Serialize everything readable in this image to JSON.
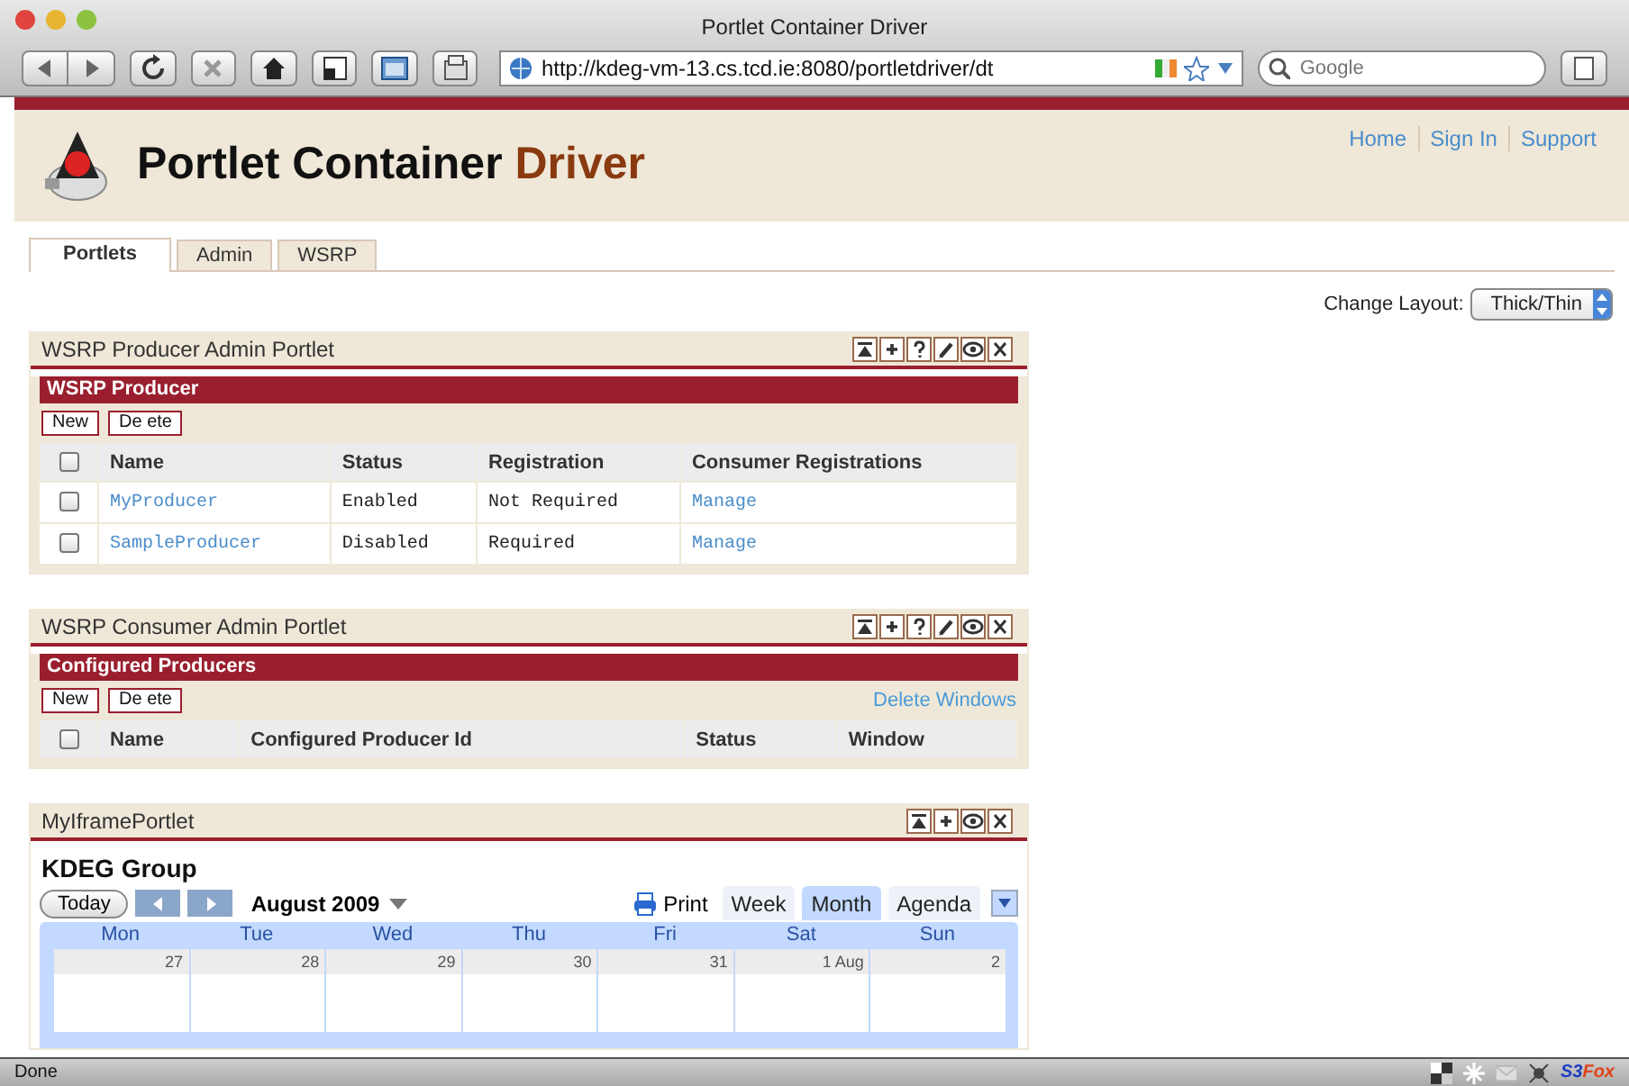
{
  "window": {
    "title": "Portlet Container Driver"
  },
  "toolbar": {
    "buttons": [
      {
        "kind": "back"
      },
      {
        "kind": "forward"
      },
      {
        "kind": "reload"
      },
      {
        "kind": "stop"
      },
      {
        "kind": "home"
      },
      {
        "kind": "screen"
      },
      {
        "kind": "window"
      },
      {
        "kind": "tab"
      }
    ],
    "url": "http://kdeg-vm-13.cs.tcd.ie:8080/portletdriver/dt",
    "search": {
      "placeholder": "Google"
    }
  },
  "header": {
    "title": "Portlet Container",
    "title_accent": "Driver",
    "links": [
      "Home",
      "Sign In",
      "Support"
    ]
  },
  "tabs": [
    {
      "label": "Portlets",
      "selected": true
    },
    {
      "label": "Admin",
      "selected": false
    },
    {
      "label": "WSRP",
      "selected": false
    }
  ],
  "layout": {
    "label": "Change Layout:",
    "value": "Thick/Thin"
  },
  "portlets": [
    {
      "title": "WSRP Producer Admin Portlet",
      "controls": [
        {
          "kind": "minimize"
        },
        {
          "kind": "maximize"
        },
        {
          "kind": "help"
        },
        {
          "kind": "edit"
        },
        {
          "kind": "view"
        },
        {
          "kind": "close"
        }
      ],
      "kind": "table",
      "section": "WSRP Producer",
      "buttons": [
        "New",
        "De ete"
      ],
      "select_all": false,
      "columns": [
        {
          "label": "Name",
          "kind": "link"
        },
        {
          "label": "Status",
          "kind": "text"
        },
        {
          "label": "Registration",
          "kind": "text"
        },
        {
          "label": "Consumer Registrations",
          "kind": "link"
        }
      ],
      "rows": [
        {
          "checked": false,
          "cells": [
            "MyProducer",
            "Enabled",
            "Not Required",
            "Manage"
          ]
        },
        {
          "checked": false,
          "cells": [
            "SampleProducer",
            "Disabled",
            "Required",
            "Manage"
          ]
        }
      ]
    },
    {
      "title": "WSRP Consumer Admin Portlet",
      "controls": [
        {
          "kind": "minimize"
        },
        {
          "kind": "maximize"
        },
        {
          "kind": "help"
        },
        {
          "kind": "edit"
        },
        {
          "kind": "view"
        },
        {
          "kind": "close"
        }
      ],
      "kind": "table",
      "section": "Configured Producers",
      "buttons": [
        "New",
        "De ete"
      ],
      "link": "Delete Windows",
      "select_all": false,
      "columns": [
        {
          "label": "Name"
        },
        {
          "label": "Configured Producer Id"
        },
        {
          "label": "Status"
        },
        {
          "label": "Window"
        }
      ]
    },
    {
      "title": "MyIframePortlet",
      "controls": [
        {
          "kind": "minimize"
        },
        {
          "kind": "maximize"
        },
        {
          "kind": "view"
        },
        {
          "kind": "close"
        }
      ],
      "kind": "calendar",
      "calendar": {
        "title": "KDEG Group",
        "today": "Today",
        "month": "August 2009",
        "print": "Print",
        "views": [
          {
            "label": "Week",
            "selected": false
          },
          {
            "label": "Month",
            "selected": true
          },
          {
            "label": "Agenda",
            "selected": false
          }
        ],
        "days": [
          "Mon",
          "Tue",
          "Wed",
          "Thu",
          "Fri",
          "Sat",
          "Sun"
        ],
        "dates": [
          "27",
          "28",
          "29",
          "30",
          "31",
          "1 Aug",
          "2"
        ]
      }
    }
  ],
  "status_bar": {
    "text": "Done",
    "addon": [
      "S3",
      "Fox"
    ]
  }
}
